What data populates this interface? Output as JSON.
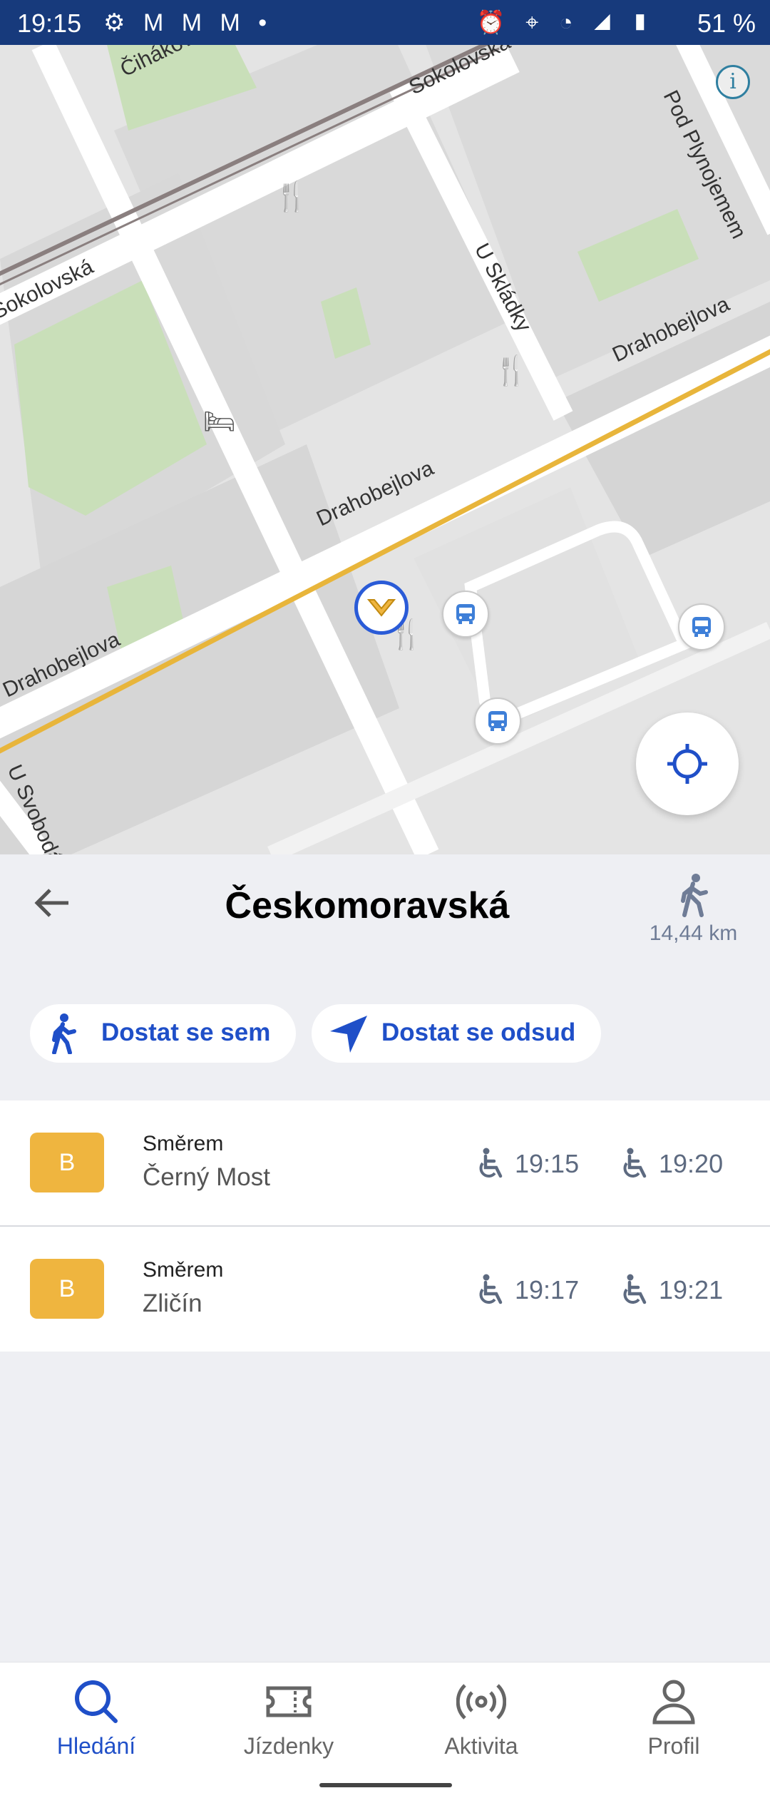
{
  "status_bar": {
    "time": "19:15",
    "battery": "51 %",
    "icons": [
      "settings-icon",
      "gmail-icon",
      "gmail-icon",
      "gmail-icon",
      "dot-icon",
      "alarm-icon",
      "location-icon",
      "wifi-icon",
      "signal-icon",
      "battery-icon"
    ]
  },
  "map": {
    "streets": [
      "Čihákova",
      "Sokolovská",
      "Pod Plynojemem",
      "U Skládky",
      "Drahobejlova",
      "Drahobejlova",
      "Drahobejlova",
      "U Svobodárny",
      "Sokolovská"
    ],
    "info_icon": "info-icon",
    "locate_icon": "crosshair-icon"
  },
  "stop": {
    "name": "Českomoravská",
    "walk_distance": "14,44 km",
    "back_icon": "arrow-left-icon",
    "walk_icon": "walking-person-icon"
  },
  "actions": {
    "get_here": "Dostat se sem",
    "get_from": "Dostat se odsud"
  },
  "departures": [
    {
      "line": "B",
      "direction_label": "Směrem",
      "direction": "Černý Most",
      "times": [
        "19:15",
        "19:20"
      ]
    },
    {
      "line": "B",
      "direction_label": "Směrem",
      "direction": "Zličín",
      "times": [
        "19:17",
        "19:21"
      ]
    }
  ],
  "nav": {
    "items": [
      {
        "label": "Hledání",
        "icon": "search-icon",
        "active": true
      },
      {
        "label": "Jízdenky",
        "icon": "ticket-icon",
        "active": false
      },
      {
        "label": "Aktivita",
        "icon": "broadcast-icon",
        "active": false
      },
      {
        "label": "Profil",
        "icon": "person-icon",
        "active": false
      }
    ]
  },
  "colors": {
    "accent": "#1f4fc8",
    "metro_b": "#efb53f",
    "status_bar": "#173a7c"
  }
}
